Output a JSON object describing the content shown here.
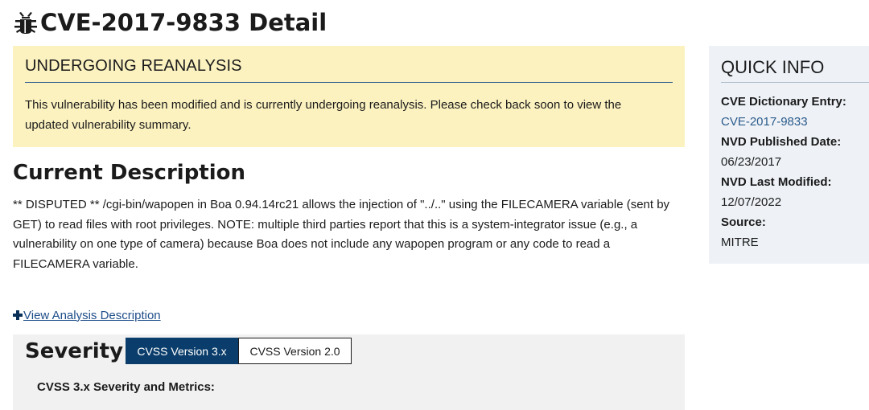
{
  "page": {
    "title": "CVE-2017-9833 Detail",
    "bug_icon": "bug-icon"
  },
  "banner": {
    "heading": "UNDERGOING REANALYSIS",
    "text": "This vulnerability has been modified and is currently undergoing reanalysis. Please check back soon to view the updated vulnerability summary."
  },
  "description": {
    "heading": "Current Description",
    "text": "** DISPUTED ** /cgi-bin/wapopen in Boa 0.94.14rc21 allows the injection of \"../..\" using the FILECAMERA variable (sent by GET) to read files with root privileges. NOTE: multiple third parties report that this is a system-integrator issue (e.g., a vulnerability on one type of camera) because Boa does not include any wapopen program or any code to read a FILECAMERA variable.",
    "view_analysis_link": "View Analysis Description"
  },
  "severity": {
    "heading": "Severity",
    "tabs": [
      {
        "label": "CVSS Version 3.x",
        "active": true
      },
      {
        "label": "CVSS Version 2.0",
        "active": false
      }
    ],
    "metrics_label": "CVSS 3.x Severity and Metrics:"
  },
  "quick_info": {
    "title": "QUICK INFO",
    "items": [
      {
        "label": "CVE Dictionary Entry:",
        "value": "CVE-2017-9833"
      },
      {
        "label": "NVD Published Date:",
        "value": "06/23/2017"
      },
      {
        "label": "NVD Last Modified:",
        "value": "12/07/2022"
      },
      {
        "label": "Source:",
        "value": "MITRE"
      }
    ]
  },
  "colors": {
    "banner_bg": "#fcf2c0",
    "active_tab": "#0a3d6b",
    "link": "#1f4e8a",
    "quick_info_bg": "#eef2f7"
  }
}
